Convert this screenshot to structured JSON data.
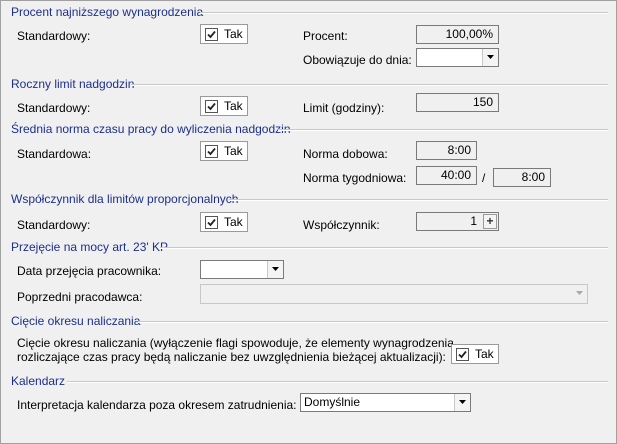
{
  "sections": {
    "min_wage": {
      "title": "Procent najniższego wynagrodzenia",
      "standard_label": "Standardowy:",
      "checkbox_label": "Tak",
      "checked": true,
      "percent_label": "Procent:",
      "percent_value": "100,00%",
      "valid_until_label": "Obowiązuje do dnia:",
      "valid_until_value": ""
    },
    "overtime_limit": {
      "title": "Roczny limit nadgodzin",
      "standard_label": "Standardowy:",
      "checkbox_label": "Tak",
      "checked": true,
      "limit_label": "Limit (godziny):",
      "limit_value": "150"
    },
    "avg_norm": {
      "title": "Średnia norma czasu pracy do wyliczenia nadgodzin",
      "standard_label": "Standardowa:",
      "checkbox_label": "Tak",
      "checked": true,
      "daily_label": "Norma dobowa:",
      "daily_value": "8:00",
      "weekly_label": "Norma tygodniowa:",
      "weekly_value": "40:00",
      "weekly_separator": "/",
      "weekly_value2": "8:00"
    },
    "coefficient": {
      "title": "Współczynnik dla limitów proporcjonalnych",
      "standard_label": "Standardowy:",
      "checkbox_label": "Tak",
      "checked": true,
      "coef_label": "Współczynnik:",
      "coef_value": "1",
      "spin_symbol": "+"
    },
    "takeover": {
      "title": "Przejęcie na mocy art. 23' KP",
      "date_label": "Data przejęcia pracownika:",
      "date_value": "",
      "prev_employer_label": "Poprzedni pracodawca:",
      "prev_employer_value": ""
    },
    "cut_period": {
      "title": "Cięcie okresu naliczania",
      "description_line1": "Cięcie okresu naliczania (wyłączenie flagi spowoduje, że elementy wynagrodzenia",
      "description_line2": "rozliczające czas pracy będą naliczanie bez uwzględnienia bieżącej aktualizacji):",
      "checkbox_label": "Tak",
      "checked": true
    },
    "calendar": {
      "title": "Kalendarz",
      "interpretation_label": "Interpretacja kalendarza poza okresem zatrudnienia:",
      "interpretation_value": "Domyślnie"
    }
  },
  "colors": {
    "section_title": "#1c2f8f",
    "background": "#f0f0f0"
  }
}
